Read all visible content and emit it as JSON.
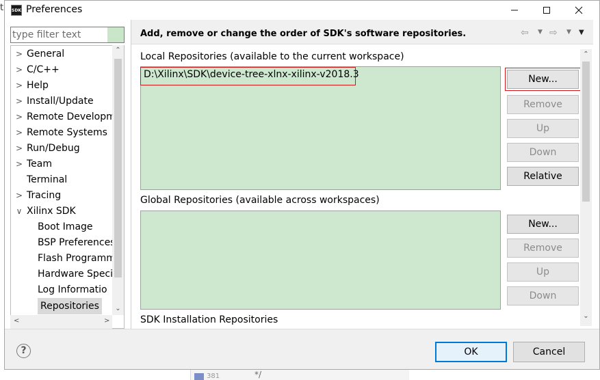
{
  "background": {
    "left_tick": "t",
    "line_number": "381",
    "comment": "*/"
  },
  "window": {
    "title": "Preferences",
    "app_icon_text": "SDK",
    "minimize_icon": "minimize-icon",
    "maximize_icon": "maximize-icon",
    "close_icon": "close-icon"
  },
  "filter": {
    "placeholder": "type filter text"
  },
  "tree": {
    "items": [
      {
        "label": "General",
        "expandable": true
      },
      {
        "label": "C/C++",
        "expandable": true
      },
      {
        "label": "Help",
        "expandable": true
      },
      {
        "label": "Install/Update",
        "expandable": true
      },
      {
        "label": "Remote Developm",
        "expandable": true
      },
      {
        "label": "Remote Systems",
        "expandable": true
      },
      {
        "label": "Run/Debug",
        "expandable": true
      },
      {
        "label": "Team",
        "expandable": true
      },
      {
        "label": "Terminal",
        "expandable": false
      },
      {
        "label": "Tracing",
        "expandable": true
      },
      {
        "label": "Xilinx SDK",
        "expandable": true,
        "expanded": true
      },
      {
        "label": "Boot Image",
        "child": true
      },
      {
        "label": "BSP Preferences",
        "child": true
      },
      {
        "label": "Flash Programm",
        "child": true
      },
      {
        "label": "Hardware Speci",
        "child": true
      },
      {
        "label": "Log Informatio",
        "child": true
      },
      {
        "label": "Repositories",
        "child": true,
        "selected": true
      }
    ]
  },
  "header": {
    "title": "Add, remove or change the order of SDK's software repositories."
  },
  "local": {
    "label": "Local Repositories (available to the current workspace)",
    "items": [
      "D:\\Xilinx\\SDK\\device-tree-xlnx-xilinx-v2018.3"
    ],
    "buttons": {
      "new": "New...",
      "remove": "Remove",
      "up": "Up",
      "down": "Down",
      "relative": "Relative"
    }
  },
  "global": {
    "label": "Global Repositories (available across workspaces)",
    "buttons": {
      "new": "New...",
      "remove": "Remove",
      "up": "Up",
      "down": "Down"
    }
  },
  "sdk_install": {
    "label": "SDK Installation Repositories"
  },
  "footer": {
    "ok": "OK",
    "cancel": "Cancel",
    "help_icon": "help-icon"
  },
  "colors": {
    "list_bg": "#cde8cf",
    "highlight": "#d01818",
    "ok_border": "#0078d7"
  }
}
